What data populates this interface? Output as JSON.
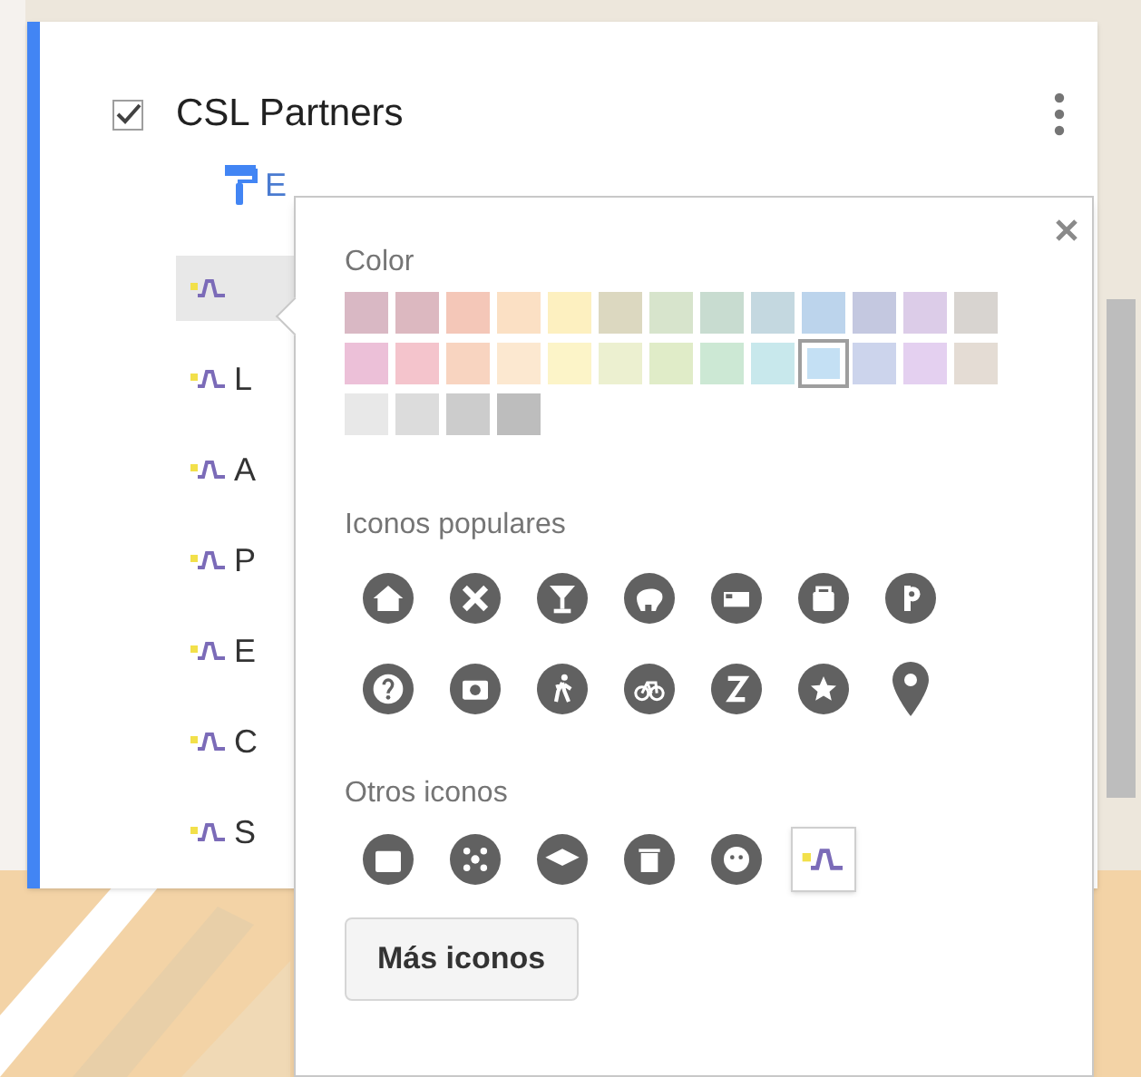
{
  "layer": {
    "title": "CSL Partners",
    "checked": true
  },
  "style_link": {
    "label": "E"
  },
  "items": [
    {
      "selected": true
    },
    {
      "label": "L",
      "selected": false
    },
    {
      "label": "A",
      "selected": false
    },
    {
      "label": "P",
      "selected": false
    },
    {
      "label": "E",
      "selected": false
    },
    {
      "label": "C",
      "selected": false
    },
    {
      "label": "S",
      "selected": false
    }
  ],
  "popup": {
    "color_title": "Color",
    "swatches": [
      {
        "color": "#d9b8c4",
        "selected": false
      },
      {
        "color": "#dcb8c0",
        "selected": false
      },
      {
        "color": "#f4c7b8",
        "selected": false
      },
      {
        "color": "#fbe0c4",
        "selected": false
      },
      {
        "color": "#fdf0c0",
        "selected": false
      },
      {
        "color": "#dcd8c0",
        "selected": false
      },
      {
        "color": "#d7e4cc",
        "selected": false
      },
      {
        "color": "#c8dcd0",
        "selected": false
      },
      {
        "color": "#c4d8e0",
        "selected": false
      },
      {
        "color": "#bcd4ec",
        "selected": false
      },
      {
        "color": "#c4c8e0",
        "selected": false
      },
      {
        "color": "#dccce8",
        "selected": false
      },
      {
        "color": "#d8d4d0",
        "selected": false
      },
      {
        "color": "#ecc0d8",
        "selected": false
      },
      {
        "color": "#f4c4cc",
        "selected": false
      },
      {
        "color": "#f8d4c0",
        "selected": false
      },
      {
        "color": "#fce8d0",
        "selected": false
      },
      {
        "color": "#fcf4c8",
        "selected": false
      },
      {
        "color": "#ecf0d0",
        "selected": false
      },
      {
        "color": "#e0ecc8",
        "selected": false
      },
      {
        "color": "#cce8d4",
        "selected": false
      },
      {
        "color": "#c8e8ec",
        "selected": false
      },
      {
        "color": "#c4e0f4",
        "selected": true
      },
      {
        "color": "#ccd4ec",
        "selected": false
      },
      {
        "color": "#e4d0f0",
        "selected": false
      },
      {
        "color": "#e4dcd4",
        "selected": false
      },
      {
        "color": "#e8e8e8",
        "selected": false
      },
      {
        "color": "#dcdcdc",
        "selected": false
      },
      {
        "color": "#cccccc",
        "selected": false
      },
      {
        "color": "#bdbdbd",
        "selected": false
      }
    ],
    "popular_title": "Iconos populares",
    "popular_icons": [
      {
        "kind": "home",
        "selected": false
      },
      {
        "kind": "cross",
        "selected": false
      },
      {
        "kind": "glass",
        "selected": false
      },
      {
        "kind": "blob",
        "selected": false
      },
      {
        "kind": "bed",
        "selected": false
      },
      {
        "kind": "bag",
        "selected": false
      },
      {
        "kind": "parking",
        "selected": false
      },
      {
        "kind": "question",
        "selected": false
      },
      {
        "kind": "camera",
        "selected": false
      },
      {
        "kind": "walker",
        "selected": false
      },
      {
        "kind": "bike",
        "selected": false
      },
      {
        "kind": "arrow",
        "selected": false
      },
      {
        "kind": "star",
        "selected": false
      },
      {
        "kind": "pin",
        "selected": false
      }
    ],
    "other_title": "Otros iconos",
    "other_icons": [
      {
        "kind": "case",
        "selected": false
      },
      {
        "kind": "dots",
        "selected": false
      },
      {
        "kind": "cap",
        "selected": false
      },
      {
        "kind": "bin",
        "selected": false
      },
      {
        "kind": "face",
        "selected": false
      },
      {
        "kind": "line",
        "selected": true
      }
    ],
    "more_button": "Más iconos"
  }
}
